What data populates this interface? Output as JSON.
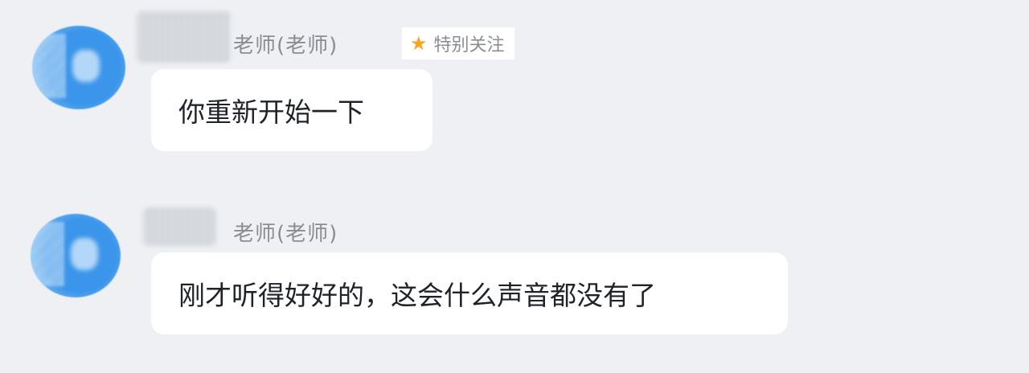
{
  "messages": [
    {
      "sender_role": "老师(老师)",
      "badge": {
        "icon": "star-icon",
        "label": "特别关注",
        "color": "#f5a623"
      },
      "text": "你重新开始一下"
    },
    {
      "sender_role": "老师(老师)",
      "text": "刚才听得好好的，这会什么声音都没有了"
    }
  ],
  "colors": {
    "background": "#eef0f4",
    "bubble": "#ffffff",
    "avatar": "#3b95ea",
    "secondary_text": "#8a8d92",
    "primary_text": "#1f2329"
  }
}
